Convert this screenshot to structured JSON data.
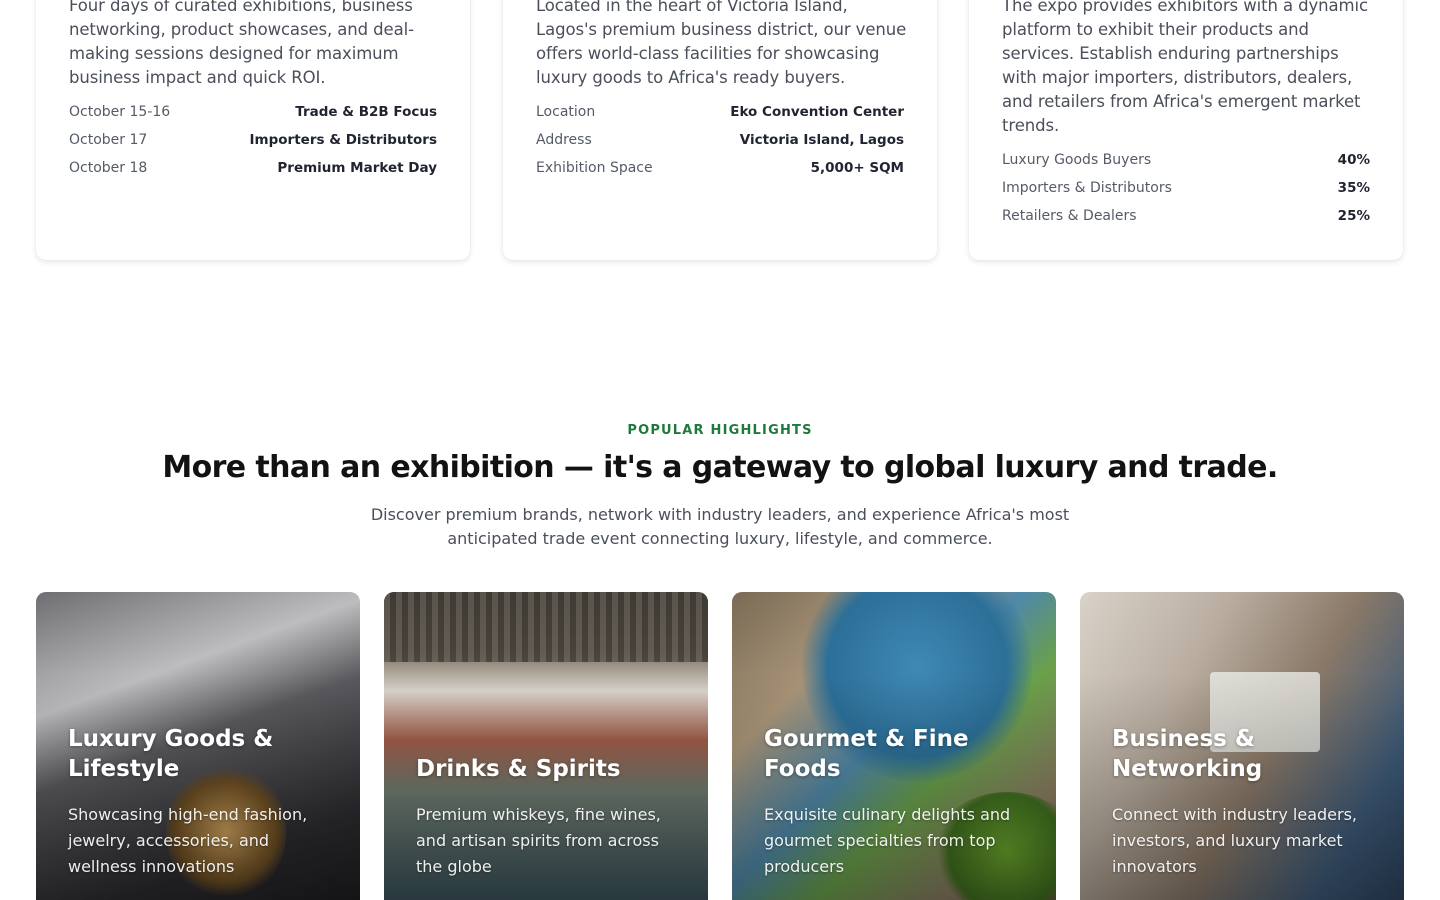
{
  "info_cards": [
    {
      "description": "Four days of curated exhibitions, business networking, product showcases, and deal-making sessions designed for maximum business impact and quick ROI.",
      "rows": [
        {
          "key": "October 15-16",
          "value": "Trade & B2B Focus"
        },
        {
          "key": "October 17",
          "value": "Importers & Distributors"
        },
        {
          "key": "October 18",
          "value": "Premium Market Day"
        }
      ]
    },
    {
      "description": "Located in the heart of Victoria Island, Lagos's premium business district, our venue offers world-class facilities for showcasing luxury goods to Africa's ready buyers.",
      "rows": [
        {
          "key": "Location",
          "value": "Eko Convention Center"
        },
        {
          "key": "Address",
          "value": "Victoria Island, Lagos"
        },
        {
          "key": "Exhibition Space",
          "value": "5,000+ SQM"
        }
      ]
    },
    {
      "description": "The expo provides exhibitors with a dynamic platform to exhibit their products and services. Establish enduring partnerships with major importers, distributors, dealers, and retailers from Africa's emergent market trends.",
      "rows": [
        {
          "key": "Luxury Goods Buyers",
          "value": "40%"
        },
        {
          "key": "Importers & Distributors",
          "value": "35%"
        },
        {
          "key": "Retailers & Dealers",
          "value": "25%"
        }
      ]
    }
  ],
  "highlights": {
    "eyebrow": "POPULAR HIGHLIGHTS",
    "headline": "More than an exhibition — it's a gateway to global luxury and trade.",
    "subtext": "Discover premium brands, network with industry leaders, and experience Africa's most anticipated trade event connecting luxury, lifestyle, and commerce.",
    "tiles": [
      {
        "title": "Luxury Goods & Lifestyle",
        "description": "Showcasing high-end fashion, jewelry, accessories, and wellness innovations"
      },
      {
        "title": "Drinks & Spirits",
        "description": "Premium whiskeys, fine wines, and artisan spirits from across the globe"
      },
      {
        "title": "Gourmet & Fine Foods",
        "description": "Exquisite culinary delights and gourmet specialties from top producers"
      },
      {
        "title": "Business & Networking",
        "description": "Connect with industry leaders, investors, and luxury market innovators"
      }
    ]
  }
}
